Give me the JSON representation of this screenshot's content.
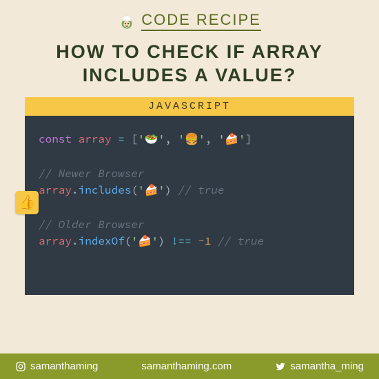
{
  "brand": {
    "label": "CODE RECIPE"
  },
  "headline": "HOW TO CHECK IF ARRAY INCLUDES A VALUE?",
  "code_header": "JAVASCRIPT",
  "code": {
    "decl": {
      "kw": "const",
      "name": "array",
      "eq": "="
    },
    "items": [
      "🥗",
      "🍔",
      "🍰"
    ],
    "block1": {
      "comment": "// Newer Browser",
      "obj": "array",
      "fn": "includes",
      "arg": "🍰",
      "tail_comment": "// true"
    },
    "block2": {
      "comment": "// Older Browser",
      "obj": "array",
      "fn": "indexOf",
      "arg": "🍰",
      "op": "!==",
      "rhs": "-1",
      "tail_comment": "// true"
    }
  },
  "thumb_emoji": "👍",
  "footer": {
    "instagram": "samanthaming",
    "site": "samanthaming.com",
    "twitter": "samantha_ming"
  }
}
